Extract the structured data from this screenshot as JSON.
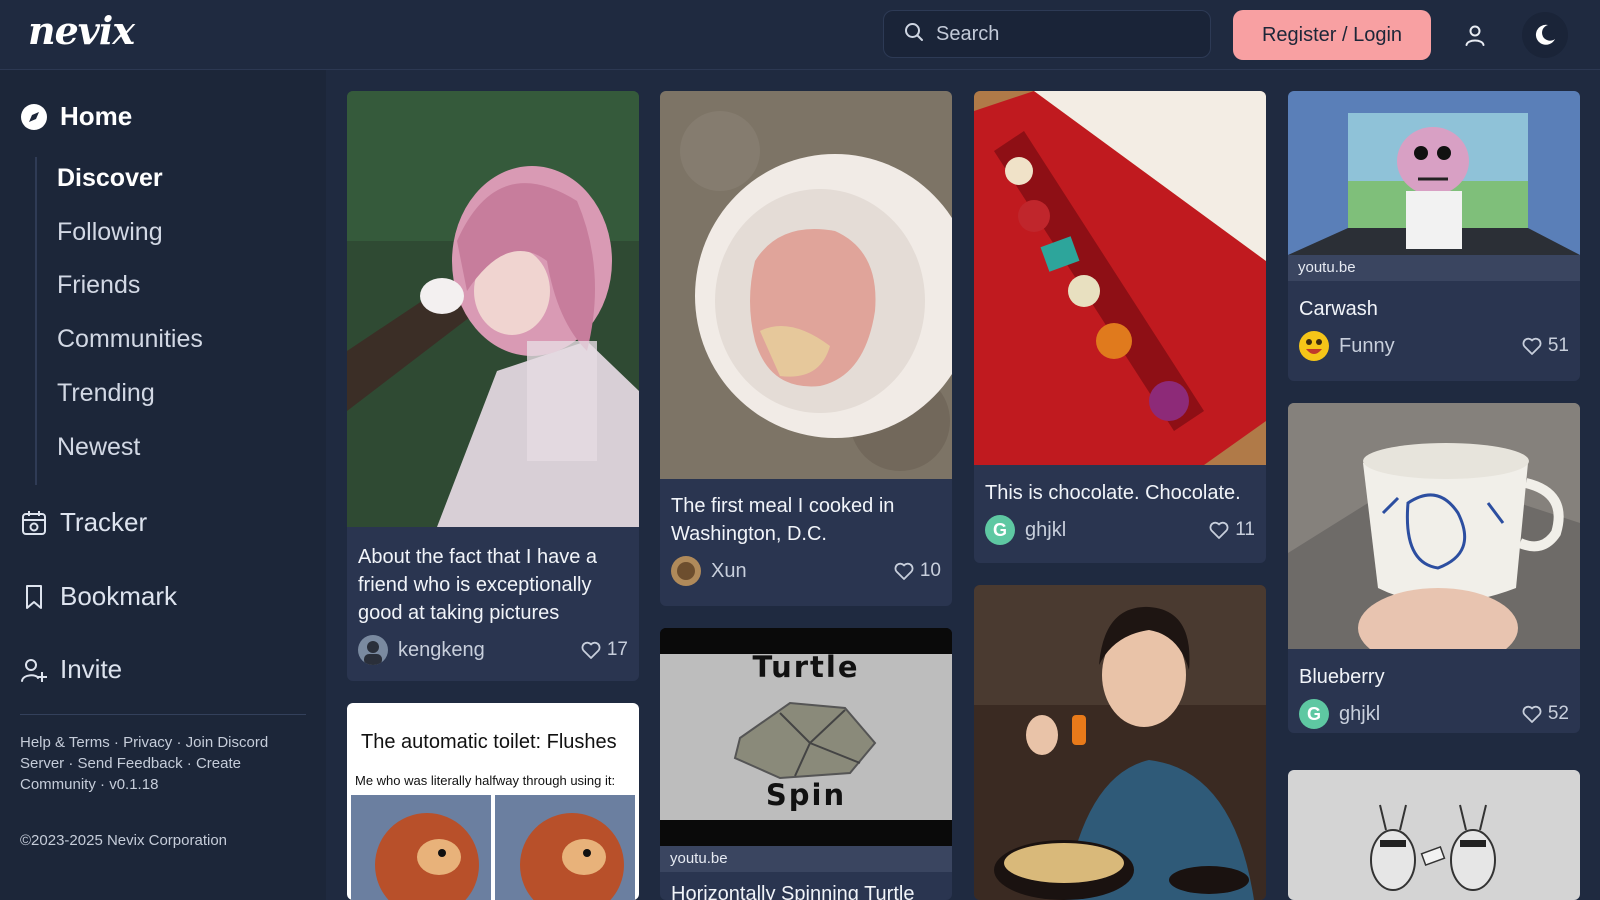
{
  "header": {
    "logo": "nevix",
    "search_placeholder": "Search",
    "login_label": "Register / Login"
  },
  "sidebar": {
    "home": "Home",
    "subnav": [
      "Discover",
      "Following",
      "Friends",
      "Communities",
      "Trending",
      "Newest"
    ],
    "active_subnav": "Discover",
    "tracker": "Tracker",
    "bookmark": "Bookmark",
    "invite": "Invite",
    "footer": {
      "help_terms": "Help & Terms",
      "privacy": "Privacy",
      "join_discord": "Join Discord Server",
      "send_feedback": "Send Feedback",
      "create_community": "Create Community",
      "version": "v0.1.18",
      "copyright": "©2023-2025 Nevix Corporation"
    }
  },
  "cards": {
    "doll": {
      "title": "About the fact that I have a friend who is exceptionally good at taking pictures",
      "author": "kengkeng",
      "likes": "17"
    },
    "meal": {
      "title": "The first meal I cooked in Washington, D.C.",
      "author": "Xun",
      "likes": "10"
    },
    "chocolate": {
      "title": "This is chocolate. Chocolate.",
      "author": "ghjkl",
      "likes": "11"
    },
    "carwash": {
      "source": "youtu.be",
      "title": "Carwash",
      "author": "Funny",
      "likes": "51"
    },
    "blueberry": {
      "title": "Blueberry",
      "author": "ghjkl",
      "likes": "52"
    },
    "toilet": {
      "caption": "The automatic toilet: Flushes",
      "subcaption": "Me who was literally halfway through using it:"
    },
    "turtle": {
      "text_top": "Turtle",
      "text_bottom": "Spin",
      "source": "youtu.be",
      "title": "Horizontally Spinning Turtle"
    }
  },
  "colors": {
    "background": "#1f2a40",
    "sidebar": "#1c2639",
    "card": "#2a3550",
    "accent_button": "#f8a0a2"
  }
}
